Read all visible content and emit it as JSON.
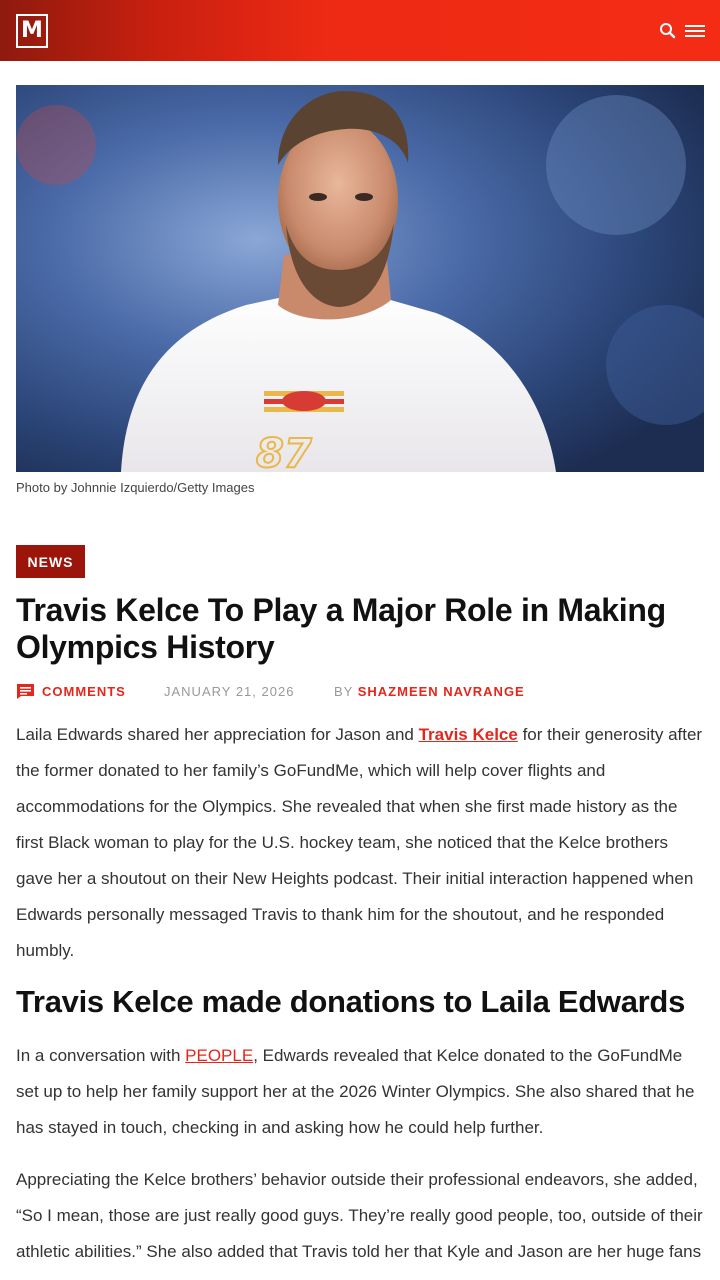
{
  "header": {
    "logo_text": "M",
    "icons": [
      "search-icon",
      "menu-icon"
    ],
    "background_color": "#f42c15"
  },
  "hero": {
    "caption": "Photo by Johnnie Izquierdo/Getty Images"
  },
  "article": {
    "category": "NEWS",
    "title": "Travis Kelce To Play a Major Role in Making Olympics History",
    "meta": {
      "comments_label": "COMMENTS",
      "date": "JANUARY 21, 2026",
      "by_label": "BY",
      "author": "SHAZMEEN NAVRANGE"
    },
    "p1": {
      "before": "Laila Edwards shared her appreciation for Jason and ",
      "link": "Travis Kelce",
      "after": " for their generosity after the former donated to her family’s GoFundMe, which will help cover flights and accommodations for the Olympics. She revealed that when she first made history as the first Black woman to play for the U.S. hockey team, she noticed that the Kelce brothers gave her a shoutout on their New Heights podcast. Their initial interaction happened when Edwards personally messaged Travis to thank him for the shoutout, and he responded humbly."
    },
    "subheading": "Travis Kelce made donations to Laila Edwards",
    "p2": {
      "before": "In a conversation with ",
      "link": "PEOPLE",
      "after": ", Edwards revealed that Kelce donated to the GoFundMe set up to help her family support her at the 2026 Winter Olympics. She also shared that he has stayed in touch, checking in and asking how he could help further."
    },
    "p3": "Appreciating the Kelce brothers’ behavior outside their professional endeavors, she added, “So I mean, those are just really good guys. They’re really good people, too, outside of their athletic abilities.” She also added that Travis told her that Kyle and Jason are her huge fans"
  },
  "colors": {
    "accent": "#e4261b",
    "tag_background": "#9b150b"
  }
}
